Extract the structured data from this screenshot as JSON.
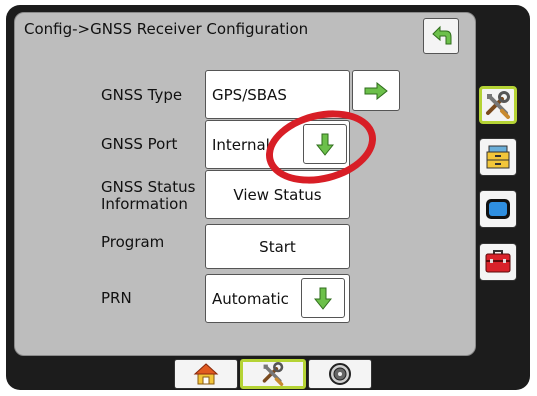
{
  "header": {
    "breadcrumb": "Config->GNSS Receiver Configuration"
  },
  "rows": {
    "gnss_type": {
      "label": "GNSS Type",
      "value": "GPS/SBAS"
    },
    "gnss_port": {
      "label": "GNSS Port",
      "value": "Internal"
    },
    "gnss_status": {
      "label_line1": "GNSS Status",
      "label_line2": "Information",
      "button": "View Status"
    },
    "program": {
      "label": "Program",
      "button": "Start"
    },
    "prn": {
      "label": "PRN",
      "value": "Automatic"
    }
  },
  "sidebar": {
    "items": [
      {
        "icon": "tools-icon",
        "active": true
      },
      {
        "icon": "file-cabinet-icon",
        "active": false
      },
      {
        "icon": "display-icon",
        "active": false
      },
      {
        "icon": "toolbox-icon",
        "active": false
      }
    ]
  },
  "bottom_nav": {
    "tabs": [
      {
        "icon": "home-icon",
        "active": false
      },
      {
        "icon": "tools-icon",
        "active": true
      },
      {
        "icon": "gauge-icon",
        "active": false
      }
    ]
  },
  "colors": {
    "accent_green": "#6cc04a",
    "active_border": "#b5d335",
    "annotation_red": "#d81e26"
  }
}
